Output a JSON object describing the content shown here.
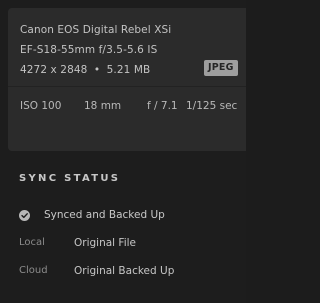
{
  "file_info": {
    "camera": "Canon EOS Digital Rebel XSi",
    "lens": "EF-S18-55mm f/3.5-5.6 IS",
    "dimensions": "4272 x 2848",
    "separator": "•",
    "file_size": "5.21 MB",
    "format_badge": "JPEG"
  },
  "exif": {
    "iso": "ISO 100",
    "focal_length": "18 mm",
    "aperture": "f / 7.1",
    "shutter": "1/125 sec"
  },
  "sync": {
    "title": "SYNC STATUS",
    "status": "Synced and Backed Up",
    "status_icon": "check-circle-icon",
    "rows": [
      {
        "label": "Local",
        "value": "Original File"
      },
      {
        "label": "Cloud",
        "value": "Original Backed Up"
      }
    ]
  }
}
